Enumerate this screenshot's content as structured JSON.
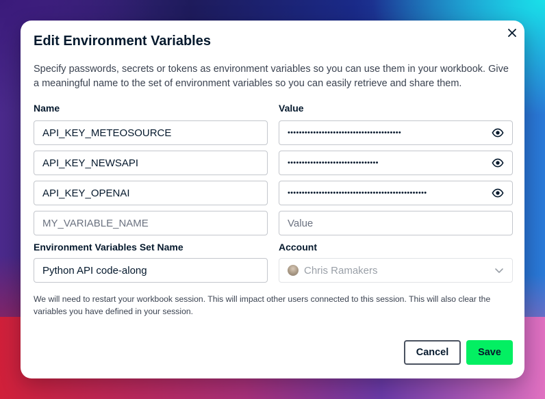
{
  "dialog": {
    "title": "Edit Environment Variables",
    "description": "Specify passwords, secrets or tokens as environment variables so you can use them in your workbook. Give a meaningful name to the set of environment variables so you can easily retrieve and share them.",
    "name_label": "Name",
    "value_label": "Value",
    "variables": [
      {
        "name": "API_KEY_METEOSOURCE",
        "value_masked": "••••••••••••••••••••••••••••••••••••••••"
      },
      {
        "name": "API_KEY_NEWSAPI",
        "value_masked": "••••••••••••••••••••••••••••••••"
      },
      {
        "name": "API_KEY_OPENAI",
        "value_masked": "•••••••••••••••••••••••••••••••••••••••••••••••••"
      }
    ],
    "new_variable": {
      "name_placeholder": "MY_VARIABLE_NAME",
      "value_placeholder": "Value"
    },
    "set_name_label": "Environment Variables Set Name",
    "set_name_value": "Python API code-along",
    "account_label": "Account",
    "account_value": "Chris Ramakers",
    "note": "We will need to restart your workbook session. This will impact other users connected to this session. This will also clear the variables you have defined in your session.",
    "cancel_label": "Cancel",
    "save_label": "Save"
  },
  "colors": {
    "primary_button": "#03ef62",
    "text_dark": "#05192d"
  },
  "icons": {
    "close": "close-icon",
    "reveal": "eye-icon",
    "dropdown": "chevron-down-icon"
  }
}
